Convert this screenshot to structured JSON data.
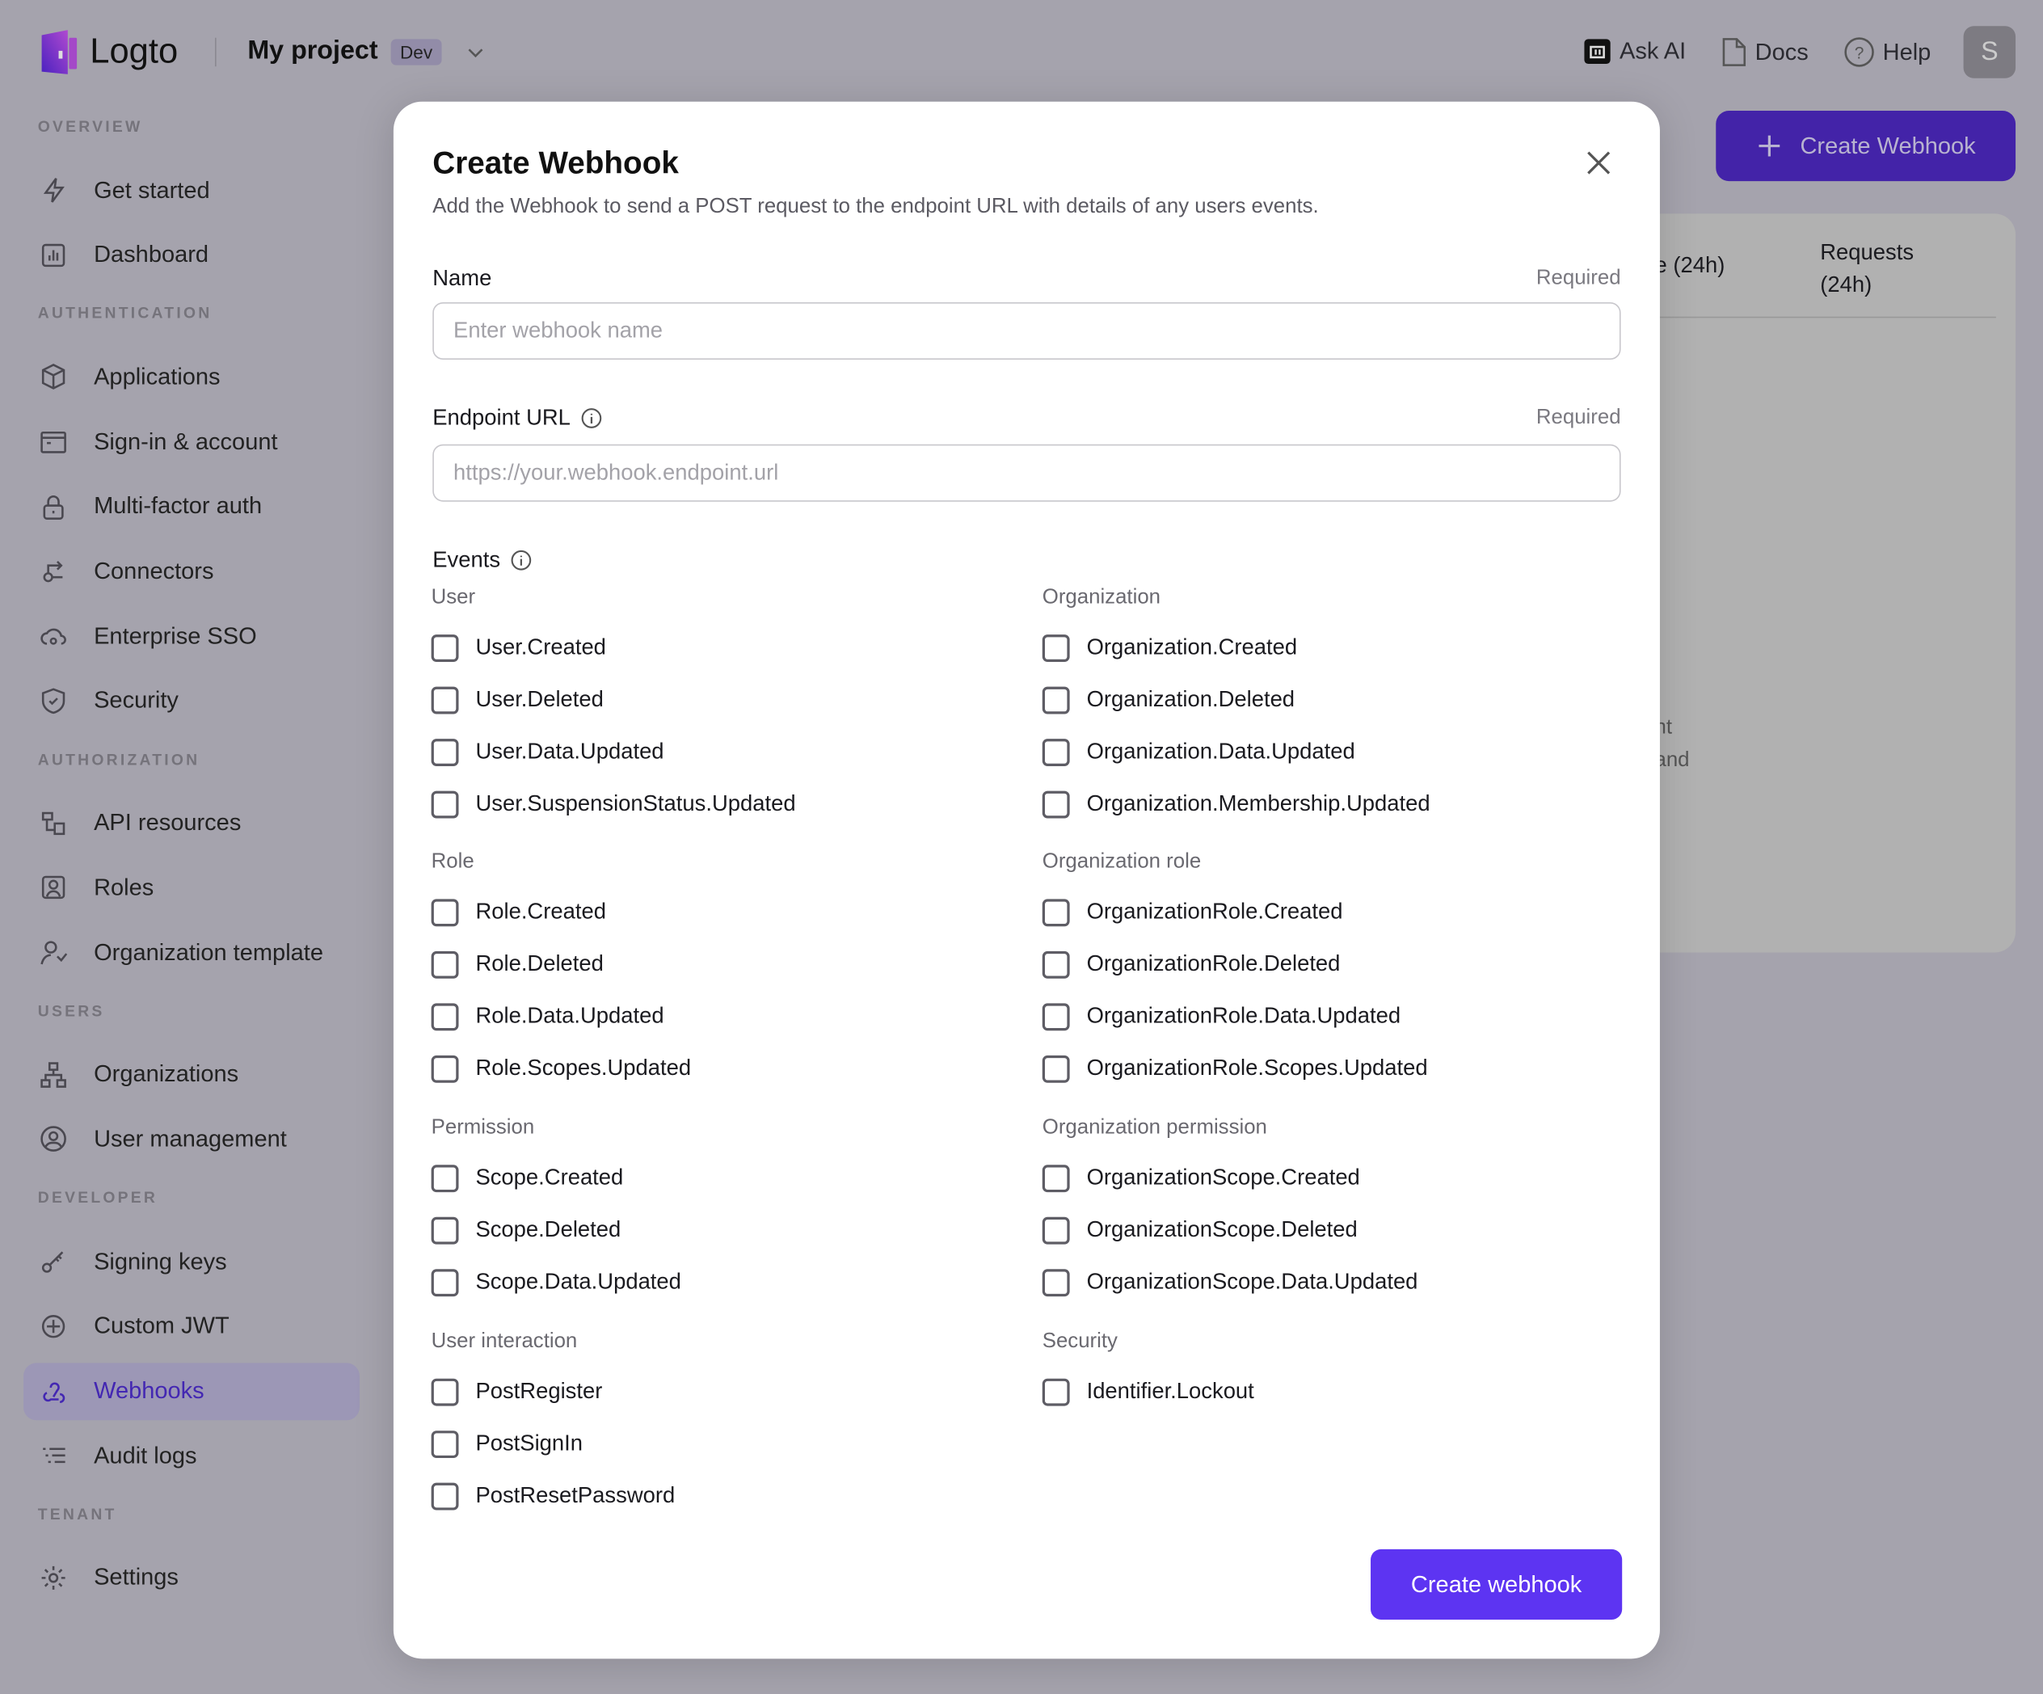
{
  "topbar": {
    "brand": "Logto",
    "project": "My project",
    "env_badge": "Dev",
    "ask_ai": "Ask AI",
    "docs": "Docs",
    "help": "Help",
    "avatar_initial": "S"
  },
  "sidebar": [
    {
      "section": "OVERVIEW",
      "items": [
        {
          "label": "Get started",
          "icon": "bolt-icon"
        },
        {
          "label": "Dashboard",
          "icon": "chart-icon"
        }
      ]
    },
    {
      "section": "AUTHENTICATION",
      "items": [
        {
          "label": "Applications",
          "icon": "cube-icon"
        },
        {
          "label": "Sign-in & account",
          "icon": "browser-icon"
        },
        {
          "label": "Multi-factor auth",
          "icon": "lock-icon"
        },
        {
          "label": "Connectors",
          "icon": "connector-icon"
        },
        {
          "label": "Enterprise SSO",
          "icon": "cloud-icon"
        },
        {
          "label": "Security",
          "icon": "shield-icon"
        }
      ]
    },
    {
      "section": "AUTHORIZATION",
      "items": [
        {
          "label": "API resources",
          "icon": "api-icon"
        },
        {
          "label": "Roles",
          "icon": "role-icon"
        },
        {
          "label": "Organization template",
          "icon": "user-template-icon"
        }
      ]
    },
    {
      "section": "USERS",
      "items": [
        {
          "label": "Organizations",
          "icon": "org-icon"
        },
        {
          "label": "User management",
          "icon": "user-circle-icon"
        }
      ]
    },
    {
      "section": "DEVELOPER",
      "items": [
        {
          "label": "Signing keys",
          "icon": "key-icon"
        },
        {
          "label": "Custom JWT",
          "icon": "jwt-icon"
        },
        {
          "label": "Webhooks",
          "icon": "webhook-icon",
          "active": true
        },
        {
          "label": "Audit logs",
          "icon": "list-icon"
        }
      ]
    },
    {
      "section": "TENANT",
      "items": [
        {
          "label": "Settings",
          "icon": "gear-icon"
        }
      ]
    }
  ],
  "background": {
    "create_button": "Create Webhook",
    "col1": "e (24h)",
    "col2a": "Requests",
    "col2b": "(24h)",
    "text1": "nt",
    "text2": "and"
  },
  "modal": {
    "title": "Create Webhook",
    "subtitle": "Add the Webhook to send a POST request to the endpoint URL with details of any users events.",
    "name_label": "Name",
    "name_required": "Required",
    "name_placeholder": "Enter webhook name",
    "url_label": "Endpoint URL",
    "url_required": "Required",
    "url_placeholder": "https://your.webhook.endpoint.url",
    "events_label": "Events",
    "groups": [
      {
        "title": "User",
        "events": [
          "User.Created",
          "User.Deleted",
          "User.Data.Updated",
          "User.SuspensionStatus.Updated"
        ]
      },
      {
        "title": "Organization",
        "events": [
          "Organization.Created",
          "Organization.Deleted",
          "Organization.Data.Updated",
          "Organization.Membership.Updated"
        ]
      },
      {
        "title": "Role",
        "events": [
          "Role.Created",
          "Role.Deleted",
          "Role.Data.Updated",
          "Role.Scopes.Updated"
        ]
      },
      {
        "title": "Organization role",
        "events": [
          "OrganizationRole.Created",
          "OrganizationRole.Deleted",
          "OrganizationRole.Data.Updated",
          "OrganizationRole.Scopes.Updated"
        ]
      },
      {
        "title": "Permission",
        "events": [
          "Scope.Created",
          "Scope.Deleted",
          "Scope.Data.Updated"
        ]
      },
      {
        "title": "Organization permission",
        "events": [
          "OrganizationScope.Created",
          "OrganizationScope.Deleted",
          "OrganizationScope.Data.Updated"
        ]
      },
      {
        "title": "User interaction",
        "events": [
          "PostRegister",
          "PostSignIn",
          "PostResetPassword"
        ]
      },
      {
        "title": "Security",
        "events": [
          "Identifier.Lockout"
        ]
      }
    ],
    "submit": "Create webhook"
  },
  "colors": {
    "accent": "#5d34f2",
    "overlay": "#a5a3ad"
  }
}
